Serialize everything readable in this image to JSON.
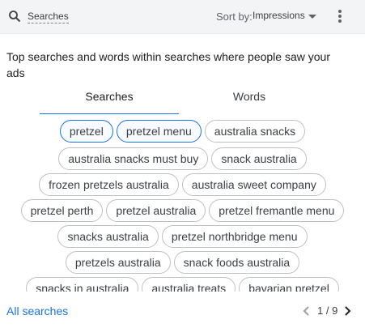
{
  "header": {
    "title": "Searches",
    "sort_label": "Sort by:",
    "sort_value": "Impressions"
  },
  "description": "Top searches and words within searches where people saw your ads",
  "tabs": [
    {
      "label": "Searches",
      "selected": true
    },
    {
      "label": "Words",
      "selected": false
    }
  ],
  "chip_rows": [
    [
      {
        "label": "pretzel",
        "selected": true
      },
      {
        "label": "pretzel menu",
        "selected": true
      },
      {
        "label": "australia snacks",
        "selected": false
      }
    ],
    [
      {
        "label": "australia snacks must buy",
        "selected": false
      },
      {
        "label": "snack australia",
        "selected": false
      }
    ],
    [
      {
        "label": "frozen pretzels australia",
        "selected": false
      },
      {
        "label": "australia sweet company",
        "selected": false
      }
    ],
    [
      {
        "label": "pretzel perth",
        "selected": false
      },
      {
        "label": "pretzel australia",
        "selected": false
      },
      {
        "label": "pretzel fremantle menu",
        "selected": false
      }
    ],
    [
      {
        "label": "snacks australia",
        "selected": false
      },
      {
        "label": "pretzel northbridge menu",
        "selected": false
      }
    ],
    [
      {
        "label": "pretzels australia",
        "selected": false
      },
      {
        "label": "snack foods australia",
        "selected": false
      }
    ],
    [
      {
        "label": "snacks in australia",
        "selected": false
      },
      {
        "label": "australia treats",
        "selected": false
      },
      {
        "label": "bavarian pretzel",
        "selected": false
      }
    ]
  ],
  "footer": {
    "all_link": "All searches",
    "page_indicator": "1 / 9"
  },
  "colors": {
    "accent": "#1a73e8",
    "header_bg": "#f3f4f6",
    "chip_border": "#bdc1c6"
  },
  "icons": {
    "search": "search-icon",
    "dropdown": "arrow-drop-down-icon",
    "more": "more-vert-icon",
    "prev": "chevron-left-icon",
    "next": "chevron-right-icon"
  }
}
